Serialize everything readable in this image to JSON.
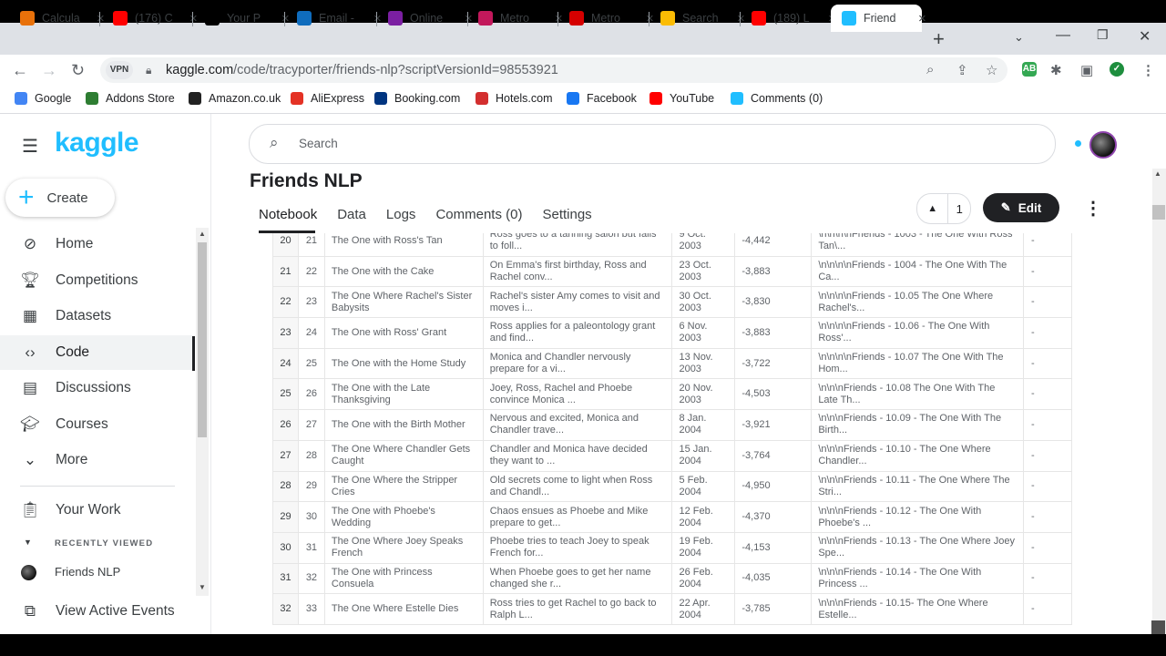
{
  "browser": {
    "tabs": [
      {
        "title": "Calcula",
        "icon": "calculator-tab-icon",
        "color": "#e8710a"
      },
      {
        "title": "(176) C",
        "icon": "youtube-tab-icon",
        "color": "#ff0000"
      },
      {
        "title": "Your P",
        "icon": "medium-tab-icon",
        "color": "#000000"
      },
      {
        "title": "Email -",
        "icon": "outlook-tab-icon",
        "color": "#0f6cbd"
      },
      {
        "title": "Online",
        "icon": "online-tab-icon",
        "color": "#7b1fa2"
      },
      {
        "title": "Metro",
        "icon": "metro-tab-icon",
        "color": "#c2185b"
      },
      {
        "title": "Metro",
        "icon": "metro-m-tab-icon",
        "color": "#d50000"
      },
      {
        "title": "Search",
        "icon": "google-drive-tab-icon",
        "color": "#fbbc04"
      },
      {
        "title": "(189) L",
        "icon": "youtube-tab-icon",
        "color": "#ff0000"
      },
      {
        "title": "Friend",
        "icon": "kaggle-tab-icon",
        "color": "#20beff"
      }
    ],
    "url_domain": "kaggle.com",
    "url_path": "/code/tracyporter/friends-nlp?scriptVersionId=98553921",
    "vpn_label": "VPN",
    "bookmarks": [
      {
        "label": "Google",
        "icon": "google-icon",
        "color": "#4285f4"
      },
      {
        "label": "Addons Store",
        "icon": "addons-store-icon",
        "color": "#2e7d32"
      },
      {
        "label": "Amazon.co.uk",
        "icon": "amazon-icon",
        "color": "#222222"
      },
      {
        "label": "AliExpress",
        "icon": "aliexpress-icon",
        "color": "#e43225"
      },
      {
        "label": "Booking.com",
        "icon": "booking-icon",
        "color": "#003580"
      },
      {
        "label": "Hotels.com",
        "icon": "hotels-icon",
        "color": "#d32f2f"
      },
      {
        "label": "Facebook",
        "icon": "facebook-icon",
        "color": "#1877f2"
      },
      {
        "label": "YouTube",
        "icon": "youtube-icon",
        "color": "#ff0000"
      },
      {
        "label": "Comments (0)",
        "icon": "kaggle-k-icon",
        "color": "#20beff"
      }
    ]
  },
  "kaggle": {
    "logo": "kaggle",
    "create_label": "Create",
    "nav": [
      {
        "label": "Home",
        "icon": "compass-icon"
      },
      {
        "label": "Competitions",
        "icon": "trophy-icon"
      },
      {
        "label": "Datasets",
        "icon": "table-icon"
      },
      {
        "label": "Code",
        "icon": "code-icon"
      },
      {
        "label": "Discussions",
        "icon": "comments-icon"
      },
      {
        "label": "Courses",
        "icon": "graduation-cap-icon"
      },
      {
        "label": "More",
        "icon": "chevron-down-icon"
      }
    ],
    "your_work": "Your Work",
    "recently_viewed": "RECENTLY VIEWED",
    "recent_item": "Friends NLP",
    "view_active_events": "View Active Events",
    "search_placeholder": "Search",
    "notebook_title": "Friends NLP",
    "tabs": [
      "Notebook",
      "Data",
      "Logs",
      "Comments (0)",
      "Settings"
    ],
    "vote_count": "1",
    "edit_label": "Edit"
  },
  "table_rows": [
    [
      "20",
      "21",
      "The One with Ross's Tan",
      "Ross goes to a tanning salon but fails to foll...",
      "9 Oct. 2003",
      "-4,442",
      "\\n\\n\\n\\nFriends - 1003 - The One With Ross Tan\\...",
      "-"
    ],
    [
      "21",
      "22",
      "The One with the Cake",
      "On Emma's first birthday, Ross and Rachel conv...",
      "23 Oct. 2003",
      "-3,883",
      "\\n\\n\\n\\nFriends - 1004 - The One With The Ca...",
      "-"
    ],
    [
      "22",
      "23",
      "The One Where Rachel's Sister Babysits",
      "Rachel's sister Amy comes to visit and moves i...",
      "30 Oct. 2003",
      "-3,830",
      "\\n\\n\\n\\nFriends - 10.05 The One Where Rachel's...",
      "-"
    ],
    [
      "23",
      "24",
      "The One with Ross' Grant",
      "Ross applies for a paleontology grant and find...",
      "6 Nov. 2003",
      "-3,883",
      "\\n\\n\\n\\nFriends - 10.06 - The One With Ross'...",
      "-"
    ],
    [
      "24",
      "25",
      "The One with the Home Study",
      "Monica and Chandler nervously prepare for a vi...",
      "13 Nov. 2003",
      "-3,722",
      "\\n\\n\\n\\nFriends - 10.07 The One With The Hom...",
      "-"
    ],
    [
      "25",
      "26",
      "The One with the Late Thanksgiving",
      "Joey, Ross, Rachel and Phoebe convince Monica ...",
      "20 Nov. 2003",
      "-4,503",
      "\\n\\n\\nFriends - 10.08 The One With The Late Th...",
      "-"
    ],
    [
      "26",
      "27",
      "The One with the Birth Mother",
      "Nervous and excited, Monica and Chandler trave...",
      "8 Jan. 2004",
      "-3,921",
      "\\n\\n\\nFriends - 10.09 - The One With The Birth...",
      "-"
    ],
    [
      "27",
      "28",
      "The One Where Chandler Gets Caught",
      "Chandler and Monica have decided they want to ...",
      "15 Jan. 2004",
      "-3,764",
      "\\n\\n\\nFriends - 10.10 - The One Where Chandler...",
      "-"
    ],
    [
      "28",
      "29",
      "The One Where the Stripper Cries",
      "Old secrets come to light when Ross and Chandl...",
      "5 Feb. 2004",
      "-4,950",
      "\\n\\n\\nFriends - 10.11 - The One Where The Stri...",
      "-"
    ],
    [
      "29",
      "30",
      "The One with Phoebe's Wedding",
      "Chaos ensues as Phoebe and Mike prepare to get...",
      "12 Feb. 2004",
      "-4,370",
      "\\n\\n\\nFriends - 10.12 - The One With Phoebe's ...",
      "-"
    ],
    [
      "30",
      "31",
      "The One Where Joey Speaks French",
      "Phoebe tries to teach Joey to speak French for...",
      "19 Feb. 2004",
      "-4,153",
      "\\n\\n\\nFriends - 10.13 - The One Where Joey Spe...",
      "-"
    ],
    [
      "31",
      "32",
      "The One with Princess Consuela",
      "When Phoebe goes to get her name changed she r...",
      "26 Feb. 2004",
      "-4,035",
      "\\n\\n\\nFriends - 10.14 - The One With Princess ...",
      "-"
    ],
    [
      "32",
      "33",
      "The One Where Estelle Dies",
      "Ross tries to get Rachel to go back to Ralph L...",
      "22 Apr. 2004",
      "-3,785",
      "\\n\\n\\nFriends - 10.15- The One Where Estelle...",
      "-"
    ]
  ]
}
